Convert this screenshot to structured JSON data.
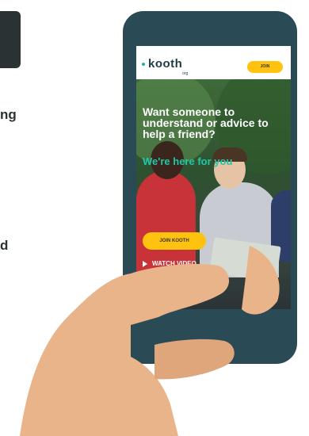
{
  "background_text": {
    "fragment_1": "ng",
    "fragment_2": "d"
  },
  "site": {
    "logo": "kooth",
    "logo_sub": "org",
    "join_button": "JOIN",
    "headline": "Want someone to understand or advice to help a friend?",
    "subheadline": "We're here for you",
    "cta_button": "JOIN KOOTH",
    "watch_link": "WATCH VIDEO"
  },
  "colors": {
    "phone": "#2a4a56",
    "accent_yellow": "#ffc20e",
    "accent_teal": "#21c7a8",
    "skin": "#e9b489"
  },
  "icons": {
    "play": "play-icon"
  }
}
